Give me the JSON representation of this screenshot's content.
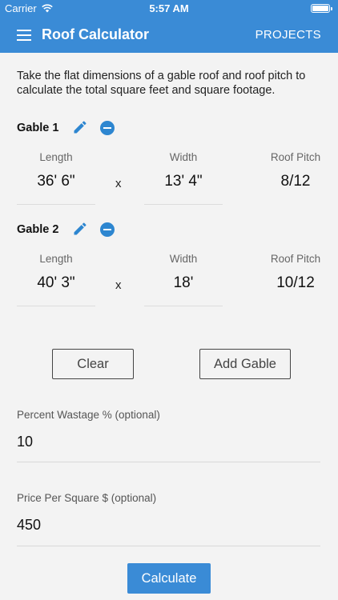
{
  "status_bar": {
    "carrier": "Carrier",
    "time": "5:57 AM"
  },
  "app_bar": {
    "title": "Roof Calculator",
    "projects_label": "PROJECTS"
  },
  "intro": "Take the flat dimensions of a gable roof and roof pitch to calculate the total square feet and square footage.",
  "gables": [
    {
      "title": "Gable 1",
      "length_label": "Length",
      "width_label": "Width",
      "pitch_label": "Roof Pitch",
      "length": "36' 6\"",
      "times": "x",
      "width": "13' 4\"",
      "pitch": "8/12"
    },
    {
      "title": "Gable 2",
      "length_label": "Length",
      "width_label": "Width",
      "pitch_label": "Roof Pitch",
      "length": "40' 3\"",
      "times": "x",
      "width": "18'",
      "pitch": "10/12"
    }
  ],
  "buttons": {
    "clear": "Clear",
    "add_gable": "Add Gable",
    "calculate": "Calculate"
  },
  "wastage": {
    "label": "Percent Wastage % (optional)",
    "value": "10"
  },
  "price": {
    "label": "Price Per Square $ (optional)",
    "value": "450"
  },
  "colors": {
    "primary": "#3a8bd6",
    "background": "#f3f3f3",
    "icon": "#2d86d0"
  }
}
